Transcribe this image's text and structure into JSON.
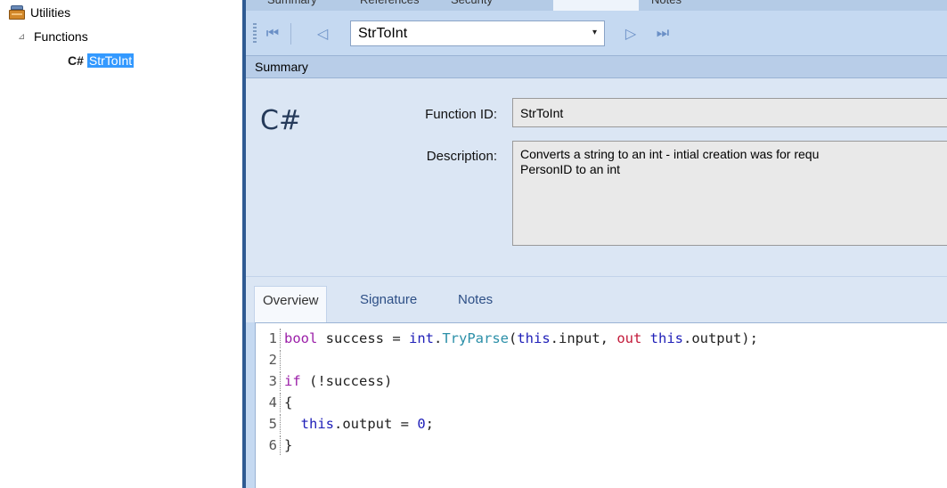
{
  "tree": {
    "root": {
      "label": "Utilities",
      "icon": "database-icon"
    },
    "group": {
      "label": "Functions",
      "toggle": "⊿"
    },
    "item": {
      "lang": "C#",
      "label": "StrToInt"
    }
  },
  "top_tabs": [
    "Summary",
    "References",
    "Security",
    "",
    "Notes"
  ],
  "navbar": {
    "first": "⏮",
    "prev": "◁",
    "selected": "StrToInt",
    "dropdown_arrow": "▾",
    "next": "▷",
    "last": "⏭"
  },
  "summary": {
    "header": "Summary",
    "lang_mark": "C#",
    "function_id_label": "Function ID:",
    "function_id_value": "StrToInt",
    "description_label": "Description:",
    "description_value": "Converts a string to an int - intial creation was for requ\nPersonID to an int"
  },
  "detail_tabs": [
    "Overview",
    "Signature",
    "Notes"
  ],
  "code": {
    "lines": [
      {
        "n": "1",
        "parts": [
          [
            "kw",
            "bool"
          ],
          [
            "t",
            " success = "
          ],
          [
            "tk",
            "int"
          ],
          [
            "t",
            "."
          ],
          [
            "fn",
            "TryParse"
          ],
          [
            "t",
            "("
          ],
          [
            "tk",
            "this"
          ],
          [
            "t",
            ".input, "
          ],
          [
            "out",
            "out"
          ],
          [
            "t",
            " "
          ],
          [
            "tk",
            "this"
          ],
          [
            "t",
            ".output);"
          ]
        ]
      },
      {
        "n": "2",
        "parts": []
      },
      {
        "n": "3",
        "parts": [
          [
            "kw",
            "if"
          ],
          [
            "t",
            " (!success)"
          ]
        ]
      },
      {
        "n": "4",
        "parts": [
          [
            "t",
            "{"
          ]
        ]
      },
      {
        "n": "5",
        "parts": [
          [
            "t",
            "  "
          ],
          [
            "tk",
            "this"
          ],
          [
            "t",
            ".output = "
          ],
          [
            "num",
            "0"
          ],
          [
            "t",
            ";"
          ]
        ]
      },
      {
        "n": "6",
        "parts": [
          [
            "t",
            "}"
          ]
        ]
      }
    ]
  },
  "colors": {
    "accent": "#3399ff",
    "keyword": "#9b1fa8",
    "type": "#1f1fb8",
    "method": "#2b8fa8",
    "out_kw": "#c31a3a"
  }
}
